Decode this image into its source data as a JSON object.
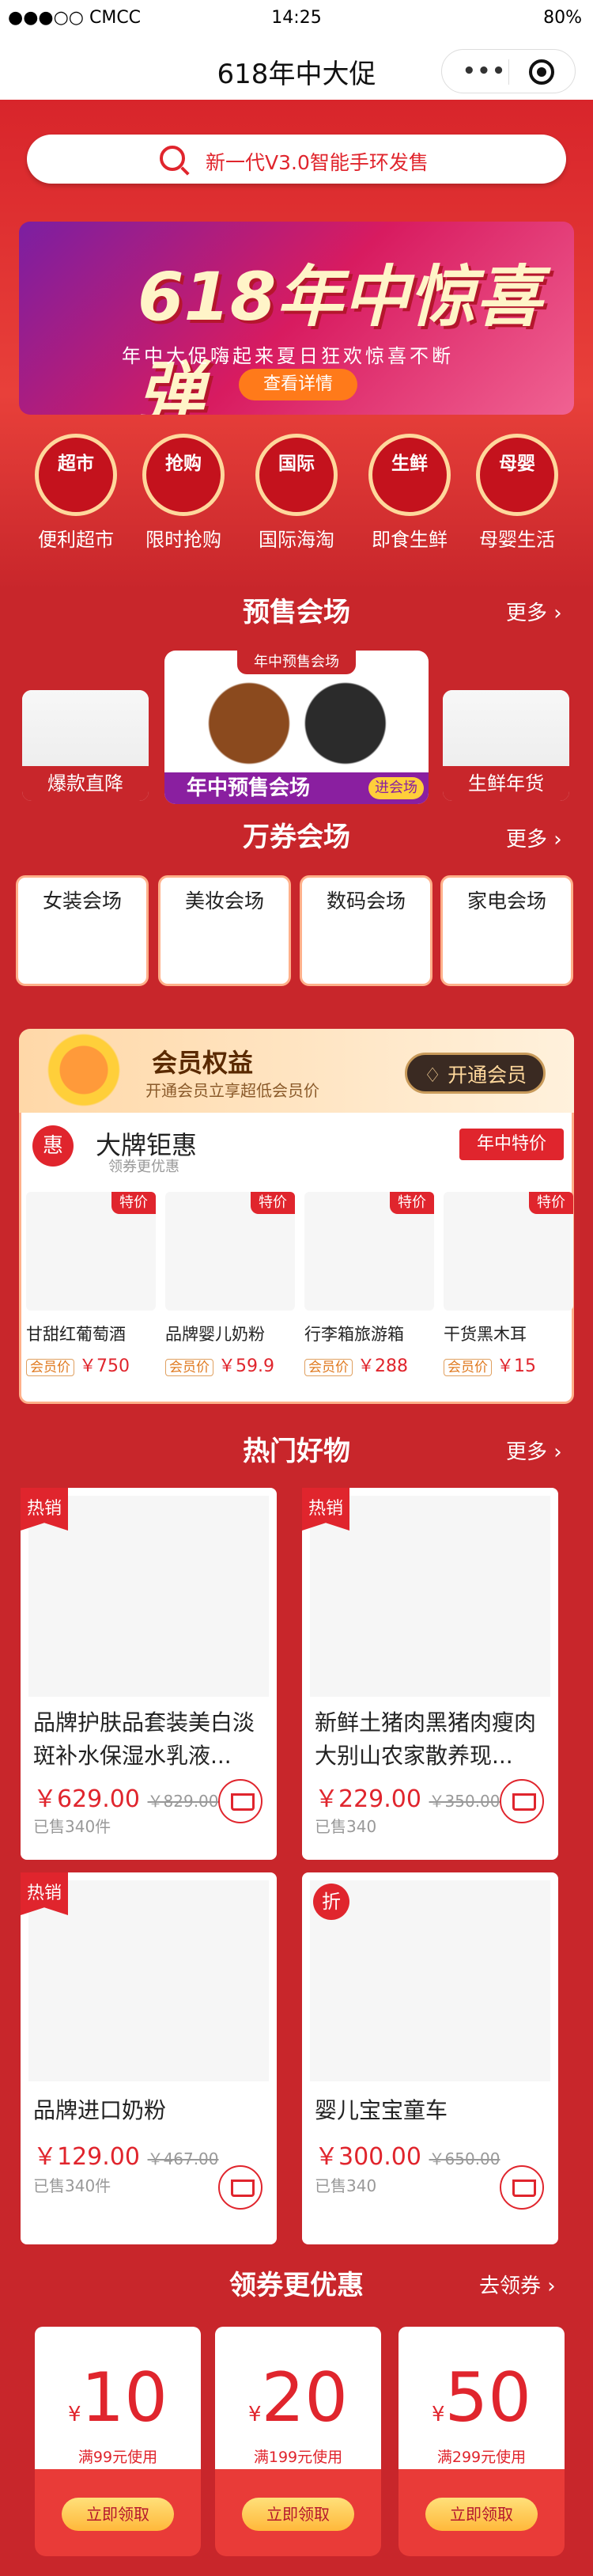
{
  "status": {
    "carrier": "●●●○○ CMCC",
    "time": "14:25",
    "battery": "80%"
  },
  "nav": {
    "title": "618年中大促"
  },
  "search": {
    "placeholder_text": "新一代V3.0智能手环发售"
  },
  "banner": {
    "title": "618年中惊喜弹",
    "subtitle": "年中大促嗨起来夏日狂欢惊喜不断",
    "button": "查看详情"
  },
  "categories": [
    {
      "icon_text": "超市",
      "label": "便利超市"
    },
    {
      "icon_text": "抢购",
      "label": "限时抢购"
    },
    {
      "icon_text": "国际",
      "label": "国际海淘"
    },
    {
      "icon_text": "生鲜",
      "label": "即食生鲜"
    },
    {
      "icon_text": "母婴",
      "label": "母婴生活"
    }
  ],
  "presale": {
    "title": "预售会场",
    "more": "更多",
    "left": "爆款直降",
    "center_tag": "年中预售会场",
    "center_label": "年中预售会场",
    "center_go": "进会场",
    "right": "生鲜年货"
  },
  "coupon_hall": {
    "title": "万券会场",
    "more": "更多",
    "items": [
      "女装会场",
      "美妆会场",
      "数码会场",
      "家电会场"
    ]
  },
  "member": {
    "title": "会员权益",
    "subtitle": "开通会员立享超低会员价",
    "button": "开通会员"
  },
  "brand": {
    "icon": "惠",
    "title": "大牌钜惠",
    "subtitle": "领券更优惠",
    "ribbon": "年中特价",
    "items": [
      {
        "tag": "特价",
        "name": "甘甜红葡萄酒",
        "badge": "会员价",
        "price": "￥750"
      },
      {
        "tag": "特价",
        "name": "品牌婴儿奶粉",
        "badge": "会员价",
        "price": "￥59.9"
      },
      {
        "tag": "特价",
        "name": "行李箱旅游箱",
        "badge": "会员价",
        "price": "￥288"
      },
      {
        "tag": "特价",
        "name": "干货黑木耳",
        "badge": "会员价",
        "price": "￥15"
      }
    ]
  },
  "hot": {
    "title": "热门好物",
    "more": "更多",
    "items": [
      {
        "tag": "热销",
        "name": "品牌护肤品套装美白淡斑补水保湿水乳液...",
        "price": "￥629.00",
        "old": "￥829.00",
        "sold": "已售340件"
      },
      {
        "tag": "热销",
        "name": "新鲜土猪肉黑猪肉瘦肉大别山农家散养现...",
        "price": "￥229.00",
        "old": "￥350.00",
        "sold": "已售340"
      },
      {
        "tag": "热销",
        "name": "品牌进口奶粉",
        "price": "￥129.00",
        "old": "￥467.00",
        "sold": "已售340件"
      },
      {
        "tag": "折",
        "name": "婴儿宝宝童车",
        "price": "￥300.00",
        "old": "￥650.00",
        "sold": "已售340"
      }
    ]
  },
  "coupons": {
    "title": "领券更优惠",
    "more": "去领券",
    "items": [
      {
        "symbol": "¥",
        "value": "10",
        "cond": "满99元使用",
        "button": "立即领取"
      },
      {
        "symbol": "¥",
        "value": "20",
        "cond": "满199元使用",
        "button": "立即领取"
      },
      {
        "symbol": "¥",
        "value": "50",
        "cond": "满299元使用",
        "button": "立即领取"
      }
    ]
  }
}
